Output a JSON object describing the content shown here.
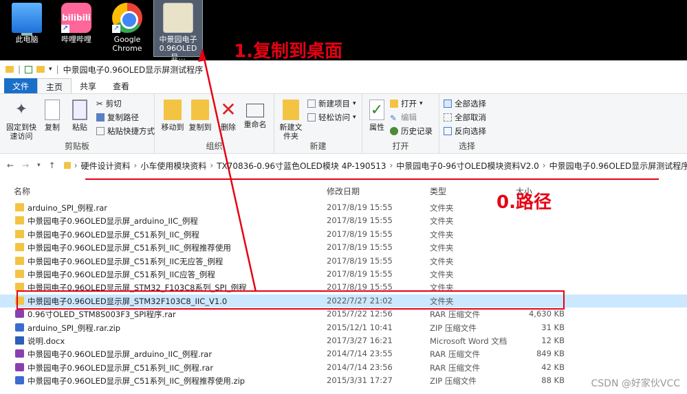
{
  "desktop": {
    "icons": [
      {
        "label": "此电脑",
        "icon": "computer-icon"
      },
      {
        "label": "哔哩哔哩",
        "icon": "bilibili-icon",
        "logo": "bilibili"
      },
      {
        "label": "Google Chrome",
        "icon": "chrome-icon"
      },
      {
        "label": "中景园电子0.96OLED显...",
        "icon": "zip-folder-icon"
      }
    ]
  },
  "annotations": {
    "copy_to_desktop": "1.复制到桌面",
    "path": "0.路径",
    "watermark": "CSDN @好家伙VCC",
    "colors": {
      "annotation_red": "#e60012",
      "selection_blue": "#cce8ff",
      "file_tab_blue": "#1a6fc9"
    }
  },
  "window": {
    "title": "中景园电子0.96OLED显示屏测试程序"
  },
  "ribbon": {
    "tabs": [
      "文件",
      "主页",
      "共享",
      "查看"
    ],
    "groups": {
      "clipboard": {
        "name": "剪贴板",
        "pin": "固定到快速访问",
        "copy": "复制",
        "paste": "粘贴",
        "cut": "剪切",
        "copy_path": "复制路径",
        "paste_shortcut": "粘贴快捷方式"
      },
      "organize": {
        "name": "组织",
        "move_to": "移动到",
        "copy_to": "复制到",
        "delete": "删除",
        "rename": "重命名"
      },
      "new": {
        "name": "新建",
        "new_folder": "新建文件夹",
        "new_item": "新建项目",
        "easy_access": "轻松访问"
      },
      "open": {
        "name": "打开",
        "properties": "属性",
        "open": "打开",
        "edit": "编辑",
        "history": "历史记录"
      },
      "select": {
        "name": "选择",
        "select_all": "全部选择",
        "select_none": "全部取消",
        "invert": "反向选择"
      }
    }
  },
  "address": {
    "crumbs": [
      "硬件设计资料",
      "小车使用模块资料",
      "TX70836-0.96寸蓝色OLED模块 4P-190513",
      "中景园电子0-96寸OLED模块资料V2.0",
      "中景园电子0.96OLED显示屏测试程序"
    ]
  },
  "columns": {
    "name": "名称",
    "date": "修改日期",
    "type": "类型",
    "size": "大小"
  },
  "files": [
    {
      "name": "arduino_SPI_例程.rar",
      "date": "2017/8/19 15:55",
      "type": "文件夹",
      "size": "",
      "kind": "folder"
    },
    {
      "name": "中景园电子0.96OLED显示屏_arduino_IIC_例程",
      "date": "2017/8/19 15:55",
      "type": "文件夹",
      "size": "",
      "kind": "folder"
    },
    {
      "name": "中景园电子0.96OLED显示屏_C51系列_IIC_例程",
      "date": "2017/8/19 15:55",
      "type": "文件夹",
      "size": "",
      "kind": "folder"
    },
    {
      "name": "中景园电子0.96OLED显示屏_C51系列_IIC_例程推荐使用",
      "date": "2017/8/19 15:55",
      "type": "文件夹",
      "size": "",
      "kind": "folder"
    },
    {
      "name": "中景园电子0.96OLED显示屏_C51系列_IIC无应答_例程",
      "date": "2017/8/19 15:55",
      "type": "文件夹",
      "size": "",
      "kind": "folder"
    },
    {
      "name": "中景园电子0.96OLED显示屏_C51系列_IIC应答_例程",
      "date": "2017/8/19 15:55",
      "type": "文件夹",
      "size": "",
      "kind": "folder"
    },
    {
      "name": "中景园电子0.96OLED显示屏_STM32_F103C8系列_SPI_例程",
      "date": "2017/8/19 15:55",
      "type": "文件夹",
      "size": "",
      "kind": "folder"
    },
    {
      "name": "中景园电子0.96OLED显示屏_STM32F103C8_IIC_V1.0",
      "date": "2022/7/27 21:02",
      "type": "文件夹",
      "size": "",
      "kind": "folder",
      "selected": true
    },
    {
      "name": "0.96寸OLED_STM8S003F3_SPI程序.rar",
      "date": "2015/7/22 12:56",
      "type": "RAR 压缩文件",
      "size": "4,630 KB",
      "kind": "rar"
    },
    {
      "name": "arduino_SPI_例程.rar.zip",
      "date": "2015/12/1 10:41",
      "type": "ZIP 压缩文件",
      "size": "31 KB",
      "kind": "zip"
    },
    {
      "name": "说明.docx",
      "date": "2017/3/27 16:21",
      "type": "Microsoft Word 文档",
      "size": "12 KB",
      "kind": "doc"
    },
    {
      "name": "中景园电子0.96OLED显示屏_arduino_IIC_例程.rar",
      "date": "2014/7/14 23:55",
      "type": "RAR 压缩文件",
      "size": "849 KB",
      "kind": "rar"
    },
    {
      "name": "中景园电子0.96OLED显示屏_C51系列_IIC_例程.rar",
      "date": "2014/7/14 23:56",
      "type": "RAR 压缩文件",
      "size": "42 KB",
      "kind": "rar"
    },
    {
      "name": "中景园电子0.96OLED显示屏_C51系列_IIC_例程推荐使用.zip",
      "date": "2015/3/31 17:27",
      "type": "ZIP 压缩文件",
      "size": "88 KB",
      "kind": "zip"
    }
  ]
}
